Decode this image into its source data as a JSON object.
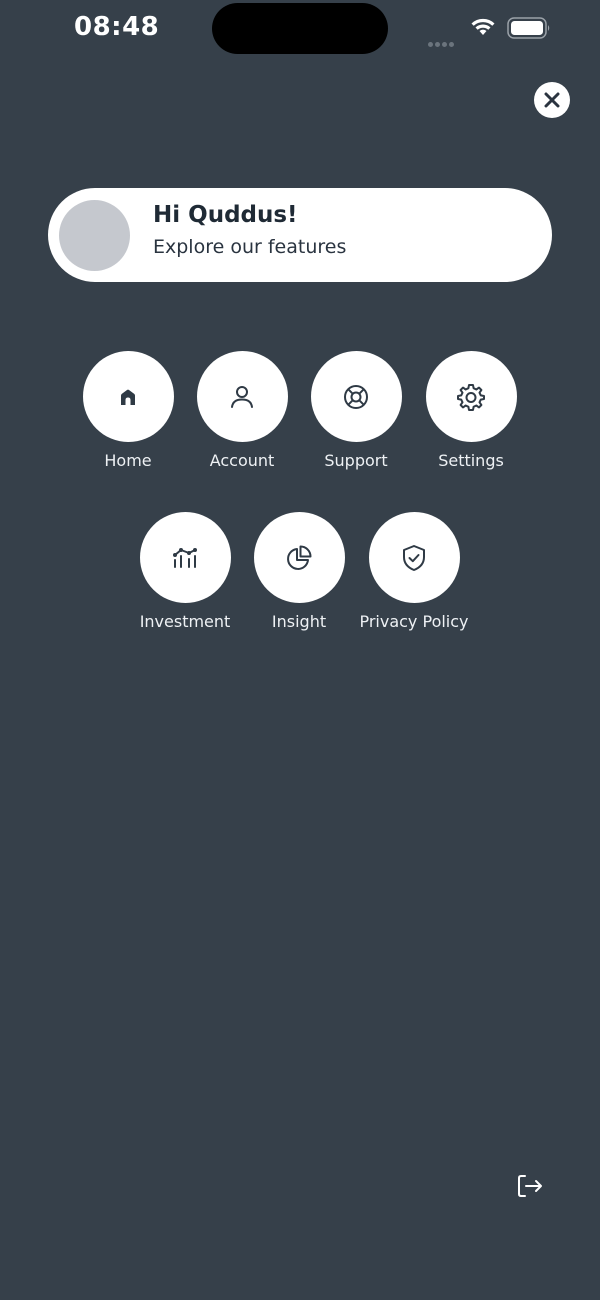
{
  "status_bar": {
    "time": "08:48"
  },
  "greeting": {
    "title": "Hi Quddus!",
    "subtitle": "Explore our features"
  },
  "menu": {
    "row1": [
      {
        "label": "Home",
        "icon": "home-icon"
      },
      {
        "label": "Account",
        "icon": "user-icon"
      },
      {
        "label": "Support",
        "icon": "lifebuoy-icon"
      },
      {
        "label": "Settings",
        "icon": "gear-icon"
      }
    ],
    "row2": [
      {
        "label": "Investment",
        "icon": "chart-icon"
      },
      {
        "label": "Insight",
        "icon": "pie-chart-icon"
      },
      {
        "label": "Privacy Policy",
        "icon": "shield-check-icon"
      }
    ]
  },
  "colors": {
    "background": "#36404a",
    "card": "#ffffff",
    "icon": "#2f3a45"
  }
}
